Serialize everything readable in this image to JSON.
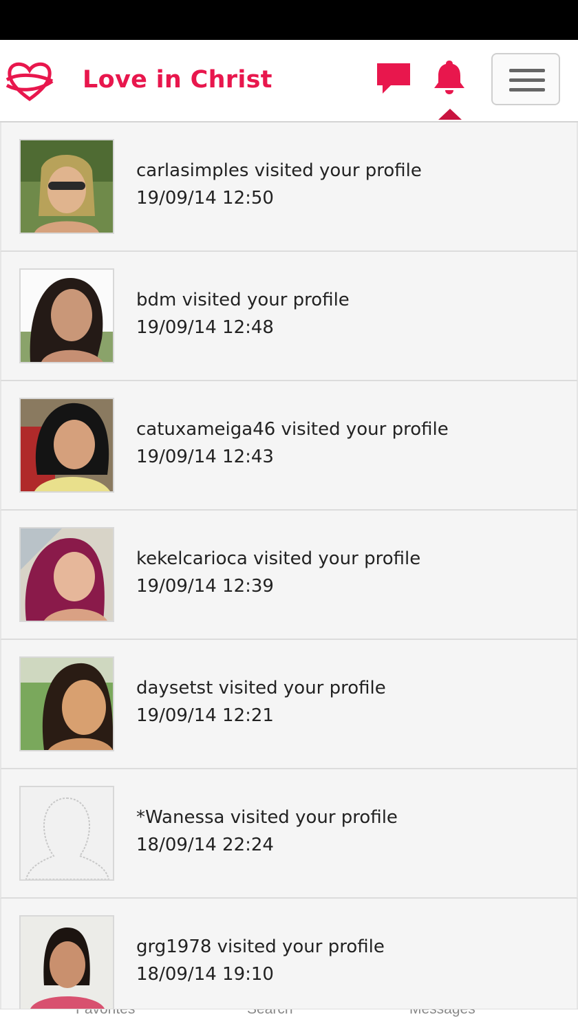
{
  "header": {
    "title": "Love in Christ",
    "brand_color": "#e8174d",
    "icons": [
      "logo-icon",
      "chat-icon",
      "bell-icon",
      "hamburger-menu-icon"
    ]
  },
  "notifications": [
    {
      "text": "carlasimples visited your profile",
      "time": "19/09/14 12:50"
    },
    {
      "text": "bdm visited your profile",
      "time": "19/09/14 12:48"
    },
    {
      "text": "catuxameiga46 visited your profile",
      "time": "19/09/14 12:43"
    },
    {
      "text": "kekelcarioca visited your profile",
      "time": "19/09/14 12:39"
    },
    {
      "text": "daysetst visited your profile",
      "time": "19/09/14 12:21"
    },
    {
      "text": "*Wanessa visited your profile",
      "time": "18/09/14 22:24"
    },
    {
      "text": "grg1978 visited your profile",
      "time": "18/09/14 19:10"
    }
  ],
  "bottom_nav": {
    "favorites": "Favorites",
    "search": "Search",
    "messages": "Messages"
  }
}
